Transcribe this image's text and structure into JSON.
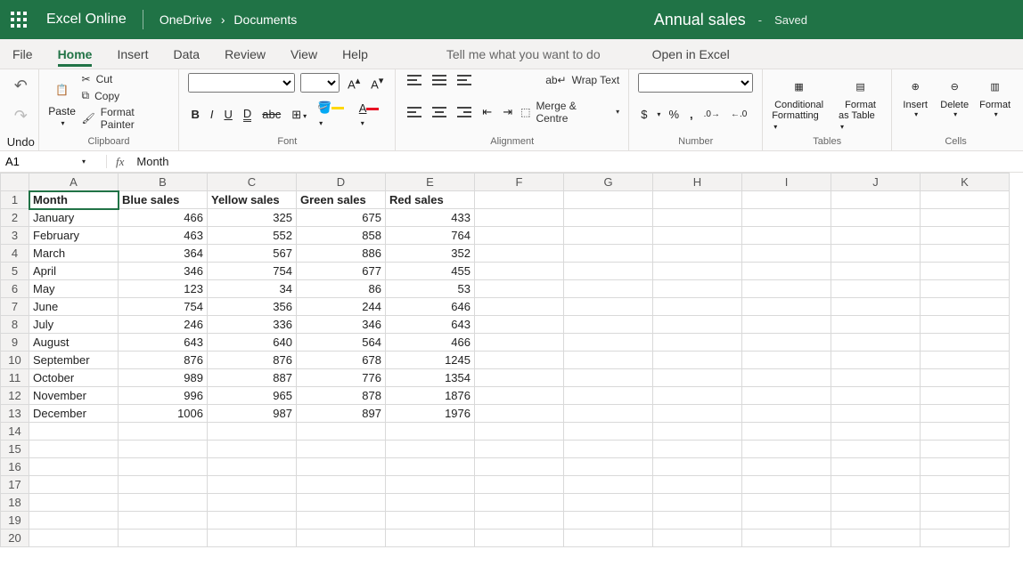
{
  "header": {
    "app_name": "Excel Online",
    "breadcrumb": [
      "OneDrive",
      "Documents"
    ],
    "doc_title": "Annual sales",
    "saved_label": "Saved"
  },
  "tabs": {
    "items": [
      "File",
      "Home",
      "Insert",
      "Data",
      "Review",
      "View",
      "Help"
    ],
    "active": "Home",
    "tell_me": "Tell me what you want to do",
    "open_excel": "Open in Excel"
  },
  "ribbon": {
    "undo_label": "Undo",
    "clipboard": {
      "paste": "Paste",
      "cut": "Cut",
      "copy": "Copy",
      "format_painter": "Format Painter",
      "label": "Clipboard"
    },
    "font": {
      "label": "Font",
      "bold": "B",
      "italic": "I",
      "underline": "U",
      "dunder": "D",
      "strike": "abc",
      "fontsize_big": "A↑",
      "fontsize_small": "A↓"
    },
    "alignment": {
      "label": "Alignment",
      "wrap": "Wrap Text",
      "merge": "Merge & Centre"
    },
    "number": {
      "label": "Number",
      "currency": "$",
      "percent": "%",
      "comma": ",",
      "inc": ".00→",
      "dec": "←.00"
    },
    "tables": {
      "cond": "Conditional",
      "cond2": "Formatting",
      "fmt": "Format",
      "fmt2": "as Table",
      "label": "Tables"
    },
    "cells": {
      "insert": "Insert",
      "delete": "Delete",
      "format": "Format",
      "label": "Cells"
    }
  },
  "fxbar": {
    "cell_ref": "A1",
    "formula": "Month"
  },
  "grid": {
    "columns": [
      "A",
      "B",
      "C",
      "D",
      "E",
      "F",
      "G",
      "H",
      "I",
      "J",
      "K"
    ],
    "selected_cell": {
      "row": 1,
      "col": "A"
    },
    "headers": [
      "Month",
      "Blue sales",
      "Yellow sales",
      "Green sales",
      "Red sales"
    ],
    "rows": [
      {
        "m": "January",
        "b": 466,
        "y": 325,
        "g": 675,
        "r": 433
      },
      {
        "m": "February",
        "b": 463,
        "y": 552,
        "g": 858,
        "r": 764
      },
      {
        "m": "March",
        "b": 364,
        "y": 567,
        "g": 886,
        "r": 352
      },
      {
        "m": "April",
        "b": 346,
        "y": 754,
        "g": 677,
        "r": 455
      },
      {
        "m": "May",
        "b": 123,
        "y": 34,
        "g": 86,
        "r": 53
      },
      {
        "m": "June",
        "b": 754,
        "y": 356,
        "g": 244,
        "r": 646
      },
      {
        "m": "July",
        "b": 246,
        "y": 336,
        "g": 346,
        "r": 643
      },
      {
        "m": "August",
        "b": 643,
        "y": 640,
        "g": 564,
        "r": 466
      },
      {
        "m": "September",
        "b": 876,
        "y": 876,
        "g": 678,
        "r": 1245
      },
      {
        "m": "October",
        "b": 989,
        "y": 887,
        "g": 776,
        "r": 1354
      },
      {
        "m": "November",
        "b": 996,
        "y": 965,
        "g": 878,
        "r": 1876
      },
      {
        "m": "December",
        "b": 1006,
        "y": 987,
        "g": 897,
        "r": 1976
      }
    ],
    "empty_rows_from": 14,
    "empty_rows_to": 20
  },
  "chart_data": {
    "type": "table",
    "title": "Annual sales",
    "categories": [
      "January",
      "February",
      "March",
      "April",
      "May",
      "June",
      "July",
      "August",
      "September",
      "October",
      "November",
      "December"
    ],
    "series": [
      {
        "name": "Blue sales",
        "values": [
          466,
          463,
          364,
          346,
          123,
          754,
          246,
          643,
          876,
          989,
          996,
          1006
        ]
      },
      {
        "name": "Yellow sales",
        "values": [
          325,
          552,
          567,
          754,
          34,
          356,
          336,
          640,
          876,
          887,
          965,
          987
        ]
      },
      {
        "name": "Green sales",
        "values": [
          675,
          858,
          886,
          677,
          86,
          244,
          346,
          564,
          678,
          776,
          878,
          897
        ]
      },
      {
        "name": "Red sales",
        "values": [
          433,
          764,
          352,
          455,
          53,
          646,
          643,
          466,
          1245,
          1354,
          1876,
          1976
        ]
      }
    ]
  }
}
